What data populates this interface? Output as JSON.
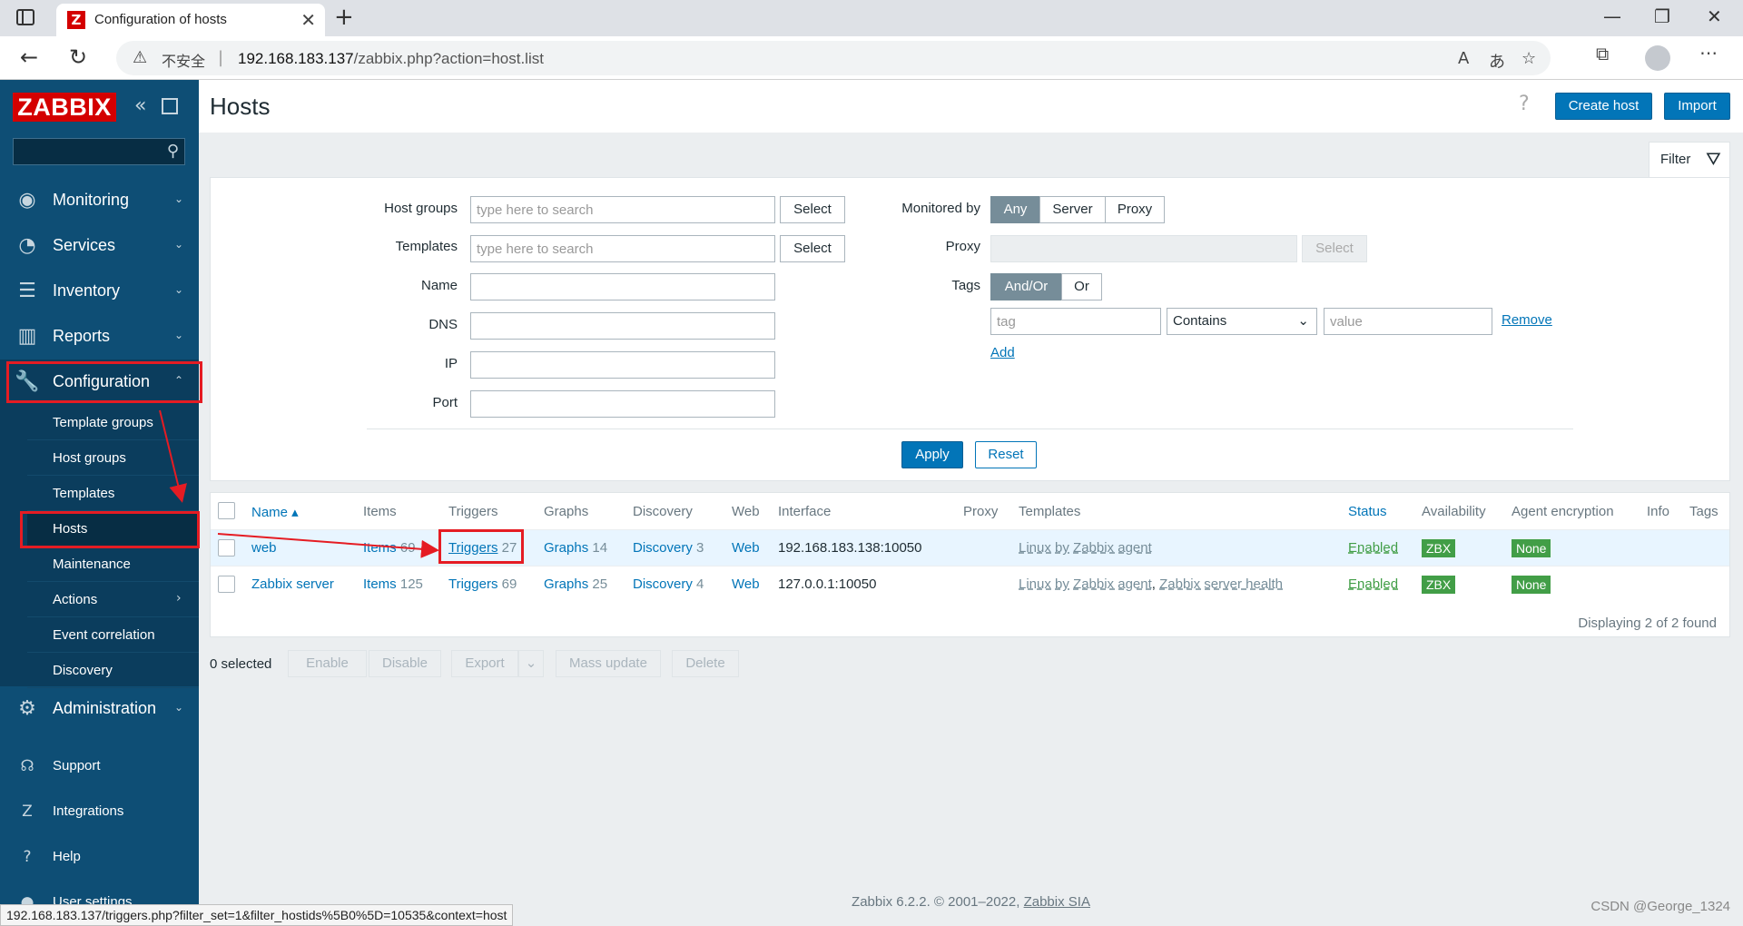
{
  "browser": {
    "tab_title": "Configuration of hosts",
    "tab_favicon": "Z",
    "security_label": "不安全",
    "url_host": "192.168.183.137",
    "url_path": "/zabbix.php?action=host.list",
    "status_url": "192.168.183.137/triggers.php?filter_set=1&filter_hostids%5B0%5D=10535&context=host"
  },
  "sidebar": {
    "logo": "ZABBIX",
    "menu": [
      {
        "label": "Monitoring",
        "icon": "eye-icon"
      },
      {
        "label": "Services",
        "icon": "clock-icon"
      },
      {
        "label": "Inventory",
        "icon": "list-icon"
      },
      {
        "label": "Reports",
        "icon": "bar-chart-icon"
      },
      {
        "label": "Configuration",
        "icon": "wrench-icon"
      },
      {
        "label": "Administration",
        "icon": "gear-icon"
      }
    ],
    "submenu": [
      "Template groups",
      "Host groups",
      "Templates",
      "Hosts",
      "Maintenance",
      "Actions",
      "Event correlation",
      "Discovery"
    ],
    "bottom": [
      {
        "label": "Support",
        "icon": "headset-icon"
      },
      {
        "label": "Integrations",
        "icon": "z-icon"
      },
      {
        "label": "Help",
        "icon": "question-icon"
      },
      {
        "label": "User settings",
        "icon": "user-icon"
      }
    ]
  },
  "header": {
    "title": "Hosts",
    "create_host": "Create host",
    "import": "Import"
  },
  "filter": {
    "tab_label": "Filter",
    "host_groups_label": "Host groups",
    "templates_label": "Templates",
    "name_label": "Name",
    "dns_label": "DNS",
    "ip_label": "IP",
    "port_label": "Port",
    "search_placeholder": "type here to search",
    "select_label": "Select",
    "monitored_by_label": "Monitored by",
    "monitored_by_options": [
      "Any",
      "Server",
      "Proxy"
    ],
    "proxy_label": "Proxy",
    "tags_label": "Tags",
    "tags_options": [
      "And/Or",
      "Or"
    ],
    "tag_placeholder": "tag",
    "tag_operator": "Contains",
    "value_placeholder": "value",
    "remove_label": "Remove",
    "add_label": "Add",
    "apply_label": "Apply",
    "reset_label": "Reset"
  },
  "table": {
    "headers": [
      "Name",
      "Items",
      "Triggers",
      "Graphs",
      "Discovery",
      "Web",
      "Interface",
      "Proxy",
      "Templates",
      "Status",
      "Availability",
      "Agent encryption",
      "Info",
      "Tags"
    ],
    "rows": [
      {
        "name": "web",
        "items_label": "Items",
        "items_count": "69",
        "triggers_label": "Triggers",
        "triggers_count": "27",
        "graphs_label": "Graphs",
        "graphs_count": "14",
        "discovery_label": "Discovery",
        "discovery_count": "3",
        "web": "Web",
        "interface": "192.168.183.138:10050",
        "templates": [
          "Linux by Zabbix agent"
        ],
        "status": "Enabled",
        "availability": "ZBX",
        "encryption": "None"
      },
      {
        "name": "Zabbix server",
        "items_label": "Items",
        "items_count": "125",
        "triggers_label": "Triggers",
        "triggers_count": "69",
        "graphs_label": "Graphs",
        "graphs_count": "25",
        "discovery_label": "Discovery",
        "discovery_count": "4",
        "web": "Web",
        "interface": "127.0.0.1:10050",
        "templates": [
          "Linux by Zabbix agent",
          "Zabbix server health"
        ],
        "status": "Enabled",
        "availability": "ZBX",
        "encryption": "None"
      }
    ],
    "displaying": "Displaying 2 of 2 found"
  },
  "actions": {
    "selected": "0 selected",
    "buttons": [
      "Enable",
      "Disable",
      "Export",
      "Mass update",
      "Delete"
    ]
  },
  "footer": {
    "text": "Zabbix 6.2.2. © 2001–2022, ",
    "link": "Zabbix SIA"
  },
  "watermark": "CSDN @George_1324",
  "colors": {
    "accent": "#0275b8",
    "sidebar": "#0e4e75",
    "logo": "#d40000",
    "status_ok": "#429e47",
    "annotation": "#e51c23"
  }
}
